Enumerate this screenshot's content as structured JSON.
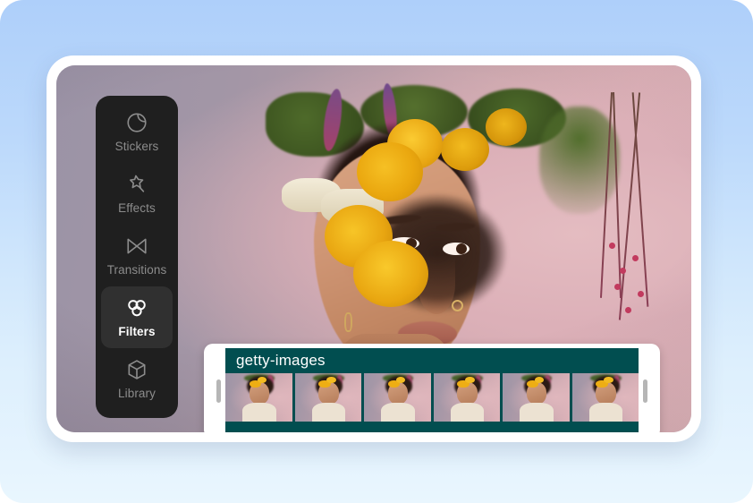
{
  "app": {
    "name": "video-editor",
    "accent_teal": "#014e50",
    "sidebar_bg": "#1f1f1f",
    "sidebar_active_bg": "#303030",
    "background_gradient_from": "#aecffa",
    "background_gradient_to": "#e9f6fe"
  },
  "sidebar": {
    "items": [
      {
        "label": "Stickers",
        "icon": "sticker-circle-icon",
        "active": false
      },
      {
        "label": "Effects",
        "icon": "magic-wand-star-icon",
        "active": false
      },
      {
        "label": "Transitions",
        "icon": "bowtie-transition-icon",
        "active": false
      },
      {
        "label": "Filters",
        "icon": "venn-circles-icon",
        "active": true
      },
      {
        "label": "Library",
        "icon": "cube-box-icon",
        "active": false
      }
    ]
  },
  "preview": {
    "alt": "Portrait of a woman wearing a crown of yellow and white flowers against a pink-lavender backdrop"
  },
  "timeline": {
    "clip": {
      "title": "getty-images",
      "thumbnail_count": 6,
      "selected": true,
      "left_handle": "trim-left",
      "right_handle": "trim-right"
    }
  }
}
